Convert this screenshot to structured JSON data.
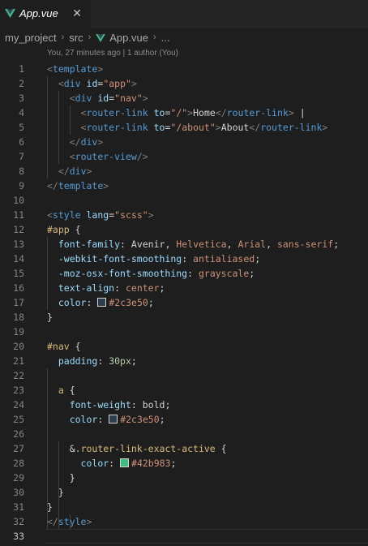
{
  "tab": {
    "title": "App.vue",
    "close_glyph": "✕",
    "icon": "vue-logo-icon"
  },
  "breadcrumb": {
    "items": [
      "my_project",
      "src",
      "App.vue",
      "..."
    ],
    "separator": "›"
  },
  "blame": "You, 27 minutes ago | 1 author (You)",
  "colors": {
    "text_color_swatch": "#2c3e50",
    "active_link_swatch": "#42b983",
    "vue_green": "#41b883",
    "vue_dark": "#35495e"
  },
  "code": {
    "line_numbers": [
      "1",
      "2",
      "3",
      "4",
      "5",
      "6",
      "7",
      "8",
      "9",
      "10",
      "11",
      "12",
      "13",
      "14",
      "15",
      "16",
      "17",
      "18",
      "19",
      "20",
      "21",
      "22",
      "23",
      "24",
      "25",
      "26",
      "27",
      "28",
      "29",
      "30",
      "31",
      "32",
      "33"
    ],
    "lines": [
      "<template>",
      "  <div id=\"app\">",
      "    <div id=\"nav\">",
      "      <router-link to=\"/\">Home</router-link> |",
      "      <router-link to=\"/about\">About</router-link>",
      "    </div>",
      "    <router-view/>",
      "  </div>",
      "</template>",
      "",
      "<style lang=\"scss\">",
      "#app {",
      "  font-family: Avenir, Helvetica, Arial, sans-serif;",
      "  -webkit-font-smoothing: antialiased;",
      "  -moz-osx-font-smoothing: grayscale;",
      "  text-align: center;",
      "  color: #2c3e50;",
      "}",
      "",
      "#nav {",
      "  padding: 30px;",
      "",
      "  a {",
      "    font-weight: bold;",
      "    color: #2c3e50;",
      "",
      "    &.router-link-exact-active {",
      "      color: #42b983;",
      "    }",
      "  }",
      "}",
      "</style>",
      ""
    ]
  }
}
